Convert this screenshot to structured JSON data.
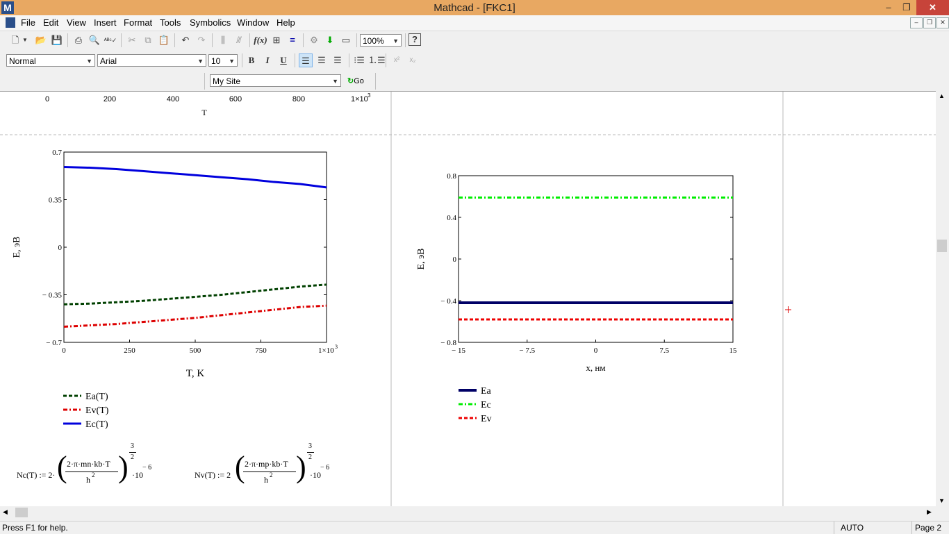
{
  "window": {
    "title": "Mathcad - [FKC1]",
    "logo": "M",
    "minimize": "‒",
    "restore": "❐",
    "close": "✕"
  },
  "menu": {
    "items": [
      "File",
      "Edit",
      "View",
      "Insert",
      "Format",
      "Tools",
      "Symbolics",
      "Window",
      "Help"
    ]
  },
  "toolbar": {
    "zoom": "100%",
    "style": "Normal",
    "font": "Arial",
    "size": "10",
    "bold": "B",
    "italic": "I",
    "underline": "U",
    "url": "My Site",
    "go": "Go",
    "help": "?"
  },
  "top_axis": {
    "ticks": [
      "0",
      "200",
      "400",
      "600",
      "800"
    ],
    "last_tick_base": "1×10",
    "last_tick_exp": "3",
    "xlabel": "T"
  },
  "chart_data": [
    {
      "type": "line",
      "xlabel": "T, K",
      "ylabel": "E, эВ",
      "xlim": [
        0,
        1000
      ],
      "ylim": [
        -0.7,
        0.7
      ],
      "xticks": [
        "0",
        "250",
        "500",
        "750"
      ],
      "x_last_tick_base": "1×10",
      "x_last_tick_exp": "3",
      "yticks": [
        "0.7",
        "0.35",
        "0",
        "− 0.35",
        "− 0.7"
      ],
      "series": [
        {
          "name": "Ea(T)",
          "color": "#004000",
          "dash": "dashed",
          "x": [
            0,
            100,
            200,
            300,
            400,
            500,
            600,
            700,
            800,
            900,
            1000
          ],
          "y": [
            -0.42,
            -0.415,
            -0.405,
            -0.395,
            -0.38,
            -0.365,
            -0.35,
            -0.33,
            -0.31,
            -0.29,
            -0.275
          ]
        },
        {
          "name": "Ev(T)",
          "color": "#dd0000",
          "dash": "dashdot",
          "x": [
            0,
            100,
            200,
            300,
            400,
            500,
            600,
            700,
            800,
            900,
            1000
          ],
          "y": [
            -0.585,
            -0.575,
            -0.565,
            -0.55,
            -0.535,
            -0.52,
            -0.5,
            -0.48,
            -0.46,
            -0.44,
            -0.43
          ]
        },
        {
          "name": "Ec(T)",
          "color": "#0000dd",
          "dash": "solid",
          "x": [
            0,
            100,
            200,
            300,
            400,
            500,
            600,
            700,
            800,
            900,
            1000
          ],
          "y": [
            0.59,
            0.585,
            0.575,
            0.56,
            0.545,
            0.53,
            0.515,
            0.5,
            0.48,
            0.465,
            0.44
          ]
        }
      ]
    },
    {
      "type": "line",
      "xlabel": "x, нм",
      "ylabel": "E, эВ",
      "xlim": [
        -15,
        15
      ],
      "ylim": [
        -0.8,
        0.8
      ],
      "xticks": [
        "− 15",
        "− 7.5",
        "0",
        "7.5",
        "15"
      ],
      "yticks": [
        "0.8",
        "0.4",
        "0",
        "− 0.4",
        "− 0.8"
      ],
      "series": [
        {
          "name": "Ea",
          "color": "#000066",
          "dash": "solid",
          "width": 4,
          "x": [
            -15,
            15
          ],
          "y": [
            -0.42,
            -0.42
          ]
        },
        {
          "name": "Ec",
          "color": "#00ee00",
          "dash": "dashdot",
          "x": [
            -15,
            15
          ],
          "y": [
            0.59,
            0.59
          ]
        },
        {
          "name": "Ev",
          "color": "#ee0000",
          "dash": "dashed",
          "x": [
            -15,
            15
          ],
          "y": [
            -0.58,
            -0.58
          ]
        }
      ]
    }
  ],
  "formulas": {
    "nc": {
      "lhs": "Nc(T) := 2·",
      "num": "2·π·mn·kb·T",
      "den": "h",
      "den_exp": "2",
      "pow_num": "3",
      "pow_den": "2",
      "tail": "·10",
      "tail_exp": "− 6"
    },
    "nv": {
      "lhs": "Nv(T) := 2",
      "num": "2·π·mp·kb·T",
      "den": "h",
      "den_exp": "2",
      "pow_num": "3",
      "pow_den": "2",
      "tail": "·10",
      "tail_exp": "− 6"
    }
  },
  "status": {
    "help": "Press F1 for help.",
    "mode": "AUTO",
    "page": "Page 2"
  }
}
